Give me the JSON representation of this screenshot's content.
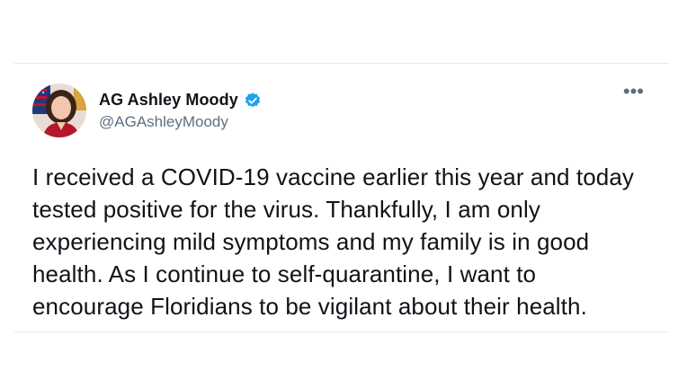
{
  "tweet": {
    "display_name": "AG Ashley Moody",
    "handle": "@AGAshleyMoody",
    "verified": true,
    "more_icon": "more-horizontal-icon",
    "more_glyph": "•••",
    "text": "I received a COVID-19 vaccine earlier this year and today tested positive for the virus. Thankfully, I am only experiencing mild symptoms and my family is in good health. As I continue to self-quarantine, I want to encourage Floridians to be vigilant about their health."
  },
  "colors": {
    "verified_blue": "#1da1f2",
    "text_primary": "#0f1419",
    "text_secondary": "#5b7083"
  }
}
